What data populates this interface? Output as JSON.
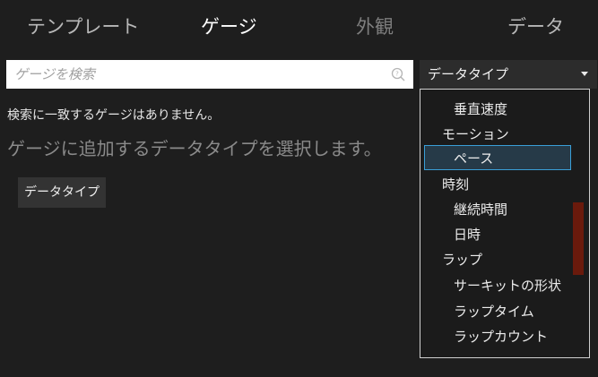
{
  "tabs": [
    {
      "label": "テンプレート"
    },
    {
      "label": "ゲージ"
    },
    {
      "label": "外観"
    },
    {
      "label": "データ"
    }
  ],
  "search": {
    "placeholder": "ゲージを検索",
    "icon": "search-icon"
  },
  "messages": {
    "no_match": "検索に一致するゲージはありません。",
    "instruction": "ゲージに追加するデータタイプを選択します。"
  },
  "datatype_button": {
    "label": "データタイプ"
  },
  "dropdown": {
    "selected_value": "データタイプ",
    "items": [
      {
        "label": "垂直速度",
        "level": 1
      },
      {
        "label": "モーション",
        "level": 0
      },
      {
        "label": "ペース",
        "level": 1,
        "selected": true
      },
      {
        "label": "時刻",
        "level": 0
      },
      {
        "label": "継続時間",
        "level": 1
      },
      {
        "label": "日時",
        "level": 1
      },
      {
        "label": "ラップ",
        "level": 0
      },
      {
        "label": "サーキットの形状",
        "level": 1
      },
      {
        "label": "ラップタイム",
        "level": 1
      },
      {
        "label": "ラップカウント",
        "level": 1
      }
    ]
  },
  "colors": {
    "background": "#1e1e1e",
    "selection_border": "#3a9fd8",
    "scroll_thumb": "#6a1a0c"
  }
}
